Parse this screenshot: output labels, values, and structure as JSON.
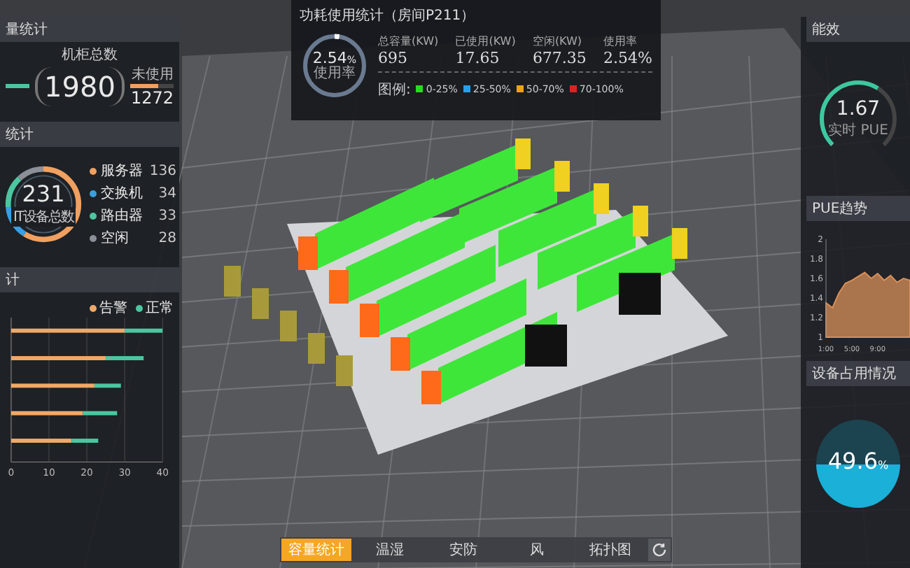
{
  "capacity_panel": {
    "title": "量统计",
    "total_label": "机柜总数",
    "total": "1980",
    "unused_label": "未使用",
    "unused": "1272",
    "unused_bar": {
      "level": 0.64
    }
  },
  "device_panel": {
    "title": "统计",
    "total": "231",
    "total_label": "IT设备总数",
    "items": [
      {
        "label": "服务器",
        "value": "136",
        "color": "#f0a060"
      },
      {
        "label": "交换机",
        "value": "34",
        "color": "#3a9ee0"
      },
      {
        "label": "路由器",
        "value": "33",
        "color": "#4cc6a0"
      },
      {
        "label": "空闲",
        "value": "28",
        "color": "#8a8f98"
      }
    ]
  },
  "alarm_panel": {
    "title": "计",
    "chart_data": {
      "type": "bar",
      "orientation": "horizontal",
      "stacked": true,
      "grid": true,
      "legend": true,
      "xticks": [
        0,
        10,
        20,
        30,
        40
      ],
      "xlim": [
        0,
        40
      ],
      "series": [
        {
          "name": "告警",
          "color": "#f0a868",
          "values": [
            30,
            25,
            22,
            19,
            16
          ]
        },
        {
          "name": "正常",
          "color": "#4cc6a0",
          "values": [
            10,
            10,
            7,
            9,
            7
          ]
        }
      ]
    }
  },
  "power_panel": {
    "title": "功耗使用统计（房间P211）",
    "gauge": {
      "value": "2.54",
      "unit": "%",
      "label": "使用率",
      "level": 0.0254
    },
    "stats": [
      {
        "label": "总容量(KW)",
        "value": "695"
      },
      {
        "label": "已使用(KW)",
        "value": "17.65"
      },
      {
        "label": "空闲(KW)",
        "value": "677.35"
      },
      {
        "label": "使用率",
        "value": "2.54%"
      }
    ],
    "legend_title": "图例:",
    "legend": [
      {
        "label": "0-25%",
        "color": "#22dd22"
      },
      {
        "label": "25-50%",
        "color": "#2a9ee8"
      },
      {
        "label": "50-70%",
        "color": "#f0a020"
      },
      {
        "label": "70-100%",
        "color": "#e02020"
      }
    ]
  },
  "efficiency_panel": {
    "title": "能效",
    "value": "1.67",
    "label": "实时 PUE",
    "level": 0.62
  },
  "pue_panel": {
    "title": "PUE趋势",
    "chart_data": {
      "type": "area",
      "x": [
        1,
        2,
        3,
        4,
        5,
        6,
        7,
        8,
        9,
        10,
        11,
        12,
        13,
        14
      ],
      "xlim": [
        1,
        14
      ],
      "ylim": [
        1,
        2
      ],
      "yticks": [
        1,
        1.2,
        1.4,
        1.6,
        1.8,
        2
      ],
      "xticks": [
        {
          "value": 1,
          "label": "1:00"
        },
        {
          "value": 5,
          "label": "5:00"
        },
        {
          "value": 9,
          "label": "9:00"
        }
      ],
      "series": [
        {
          "color": "#d8905a",
          "values": [
            1.35,
            1.3,
            1.45,
            1.55,
            1.58,
            1.62,
            1.66,
            1.6,
            1.65,
            1.58,
            1.63,
            1.56,
            1.6,
            1.58
          ]
        }
      ]
    }
  },
  "occupancy_panel": {
    "title": "设备占用情况",
    "value": "49.6",
    "unit": "%",
    "level": 0.496
  },
  "bottom_tabs": [
    {
      "label": "容量统计",
      "selected": true
    },
    {
      "label": "温湿",
      "selected": false
    },
    {
      "label": "安防",
      "selected": false
    },
    {
      "label": "风",
      "selected": false
    },
    {
      "label": "拓扑图",
      "selected": false
    }
  ]
}
